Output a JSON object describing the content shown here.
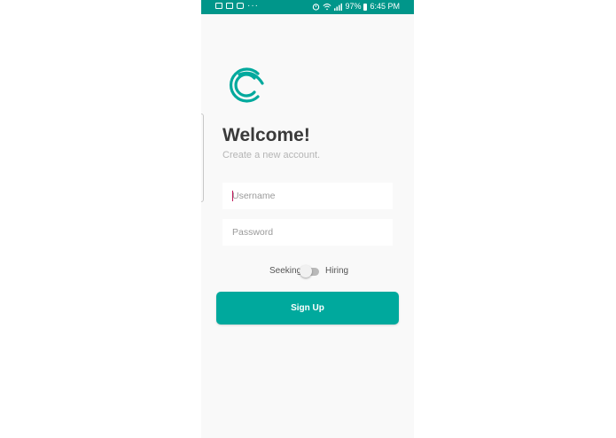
{
  "status_bar": {
    "left_icons": [
      "gallery-icon",
      "photo-icon",
      "youtube-icon"
    ],
    "more": "···",
    "battery_text": "97%",
    "time": "6:45 PM",
    "right_icons": [
      "alarm-icon",
      "wifi-icon",
      "signal-icon",
      "battery-icon"
    ]
  },
  "brand": {
    "logo_icon": "c-logo-icon",
    "accent_color": "#00a99d",
    "status_color": "#00968a"
  },
  "header": {
    "title": "Welcome!",
    "subtitle": "Create a new account."
  },
  "form": {
    "username_placeholder": "Username",
    "password_placeholder": "Password",
    "username_value": "",
    "password_value": ""
  },
  "toggle": {
    "left_label": "Seeking",
    "right_label": "Hiring",
    "state": "off"
  },
  "actions": {
    "signup_label": "Sign Up"
  }
}
